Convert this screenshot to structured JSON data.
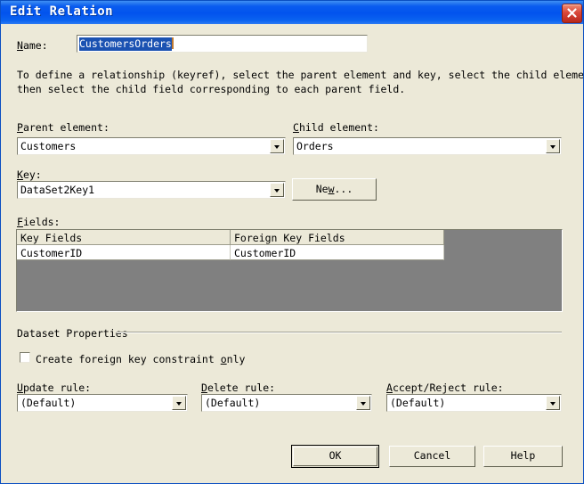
{
  "window": {
    "title": "Edit Relation",
    "close_icon": "close-icon"
  },
  "name_field": {
    "label": "Name:",
    "label_accel": "N",
    "value": "CustomersOrders",
    "selected": true
  },
  "description": {
    "line1": "To define a relationship (keyref), select the parent element and key, select the child element, and",
    "line2": "then select the child field corresponding to each parent field."
  },
  "parent_element": {
    "label": "Parent element:",
    "label_accel": "P",
    "value": "Customers"
  },
  "child_element": {
    "label": "Child element:",
    "label_accel": "C",
    "value": "Orders"
  },
  "key": {
    "label": "Key:",
    "label_accel": "K",
    "value": "DataSet2Key1",
    "new_button": "New..."
  },
  "fields": {
    "label": "Fields:",
    "label_accel": "F",
    "columns": [
      "Key Fields",
      "Foreign Key Fields"
    ],
    "rows": [
      [
        "CustomerID",
        "CustomerID"
      ]
    ]
  },
  "dataset_properties": {
    "title": "Dataset Properties",
    "checkbox": {
      "label": "Create foreign key constraint only",
      "checked": false
    },
    "update_rule": {
      "label": "Update rule:",
      "label_accel": "U",
      "value": "(Default)"
    },
    "delete_rule": {
      "label": "Delete rule:",
      "label_accel": "D",
      "value": "(Default)"
    },
    "accept_reject_rule": {
      "label": "Accept/Reject rule:",
      "label_accel": "A",
      "value": "(Default)"
    }
  },
  "buttons": {
    "ok": "OK",
    "cancel": "Cancel",
    "help": "Help"
  },
  "colors": {
    "dialog_bg": "#ECE9D8",
    "titlebar_blue": "#0253EE",
    "selection_blue": "#1B52B2",
    "grid_empty_gray": "#808080",
    "close_red": "#D9483A"
  }
}
